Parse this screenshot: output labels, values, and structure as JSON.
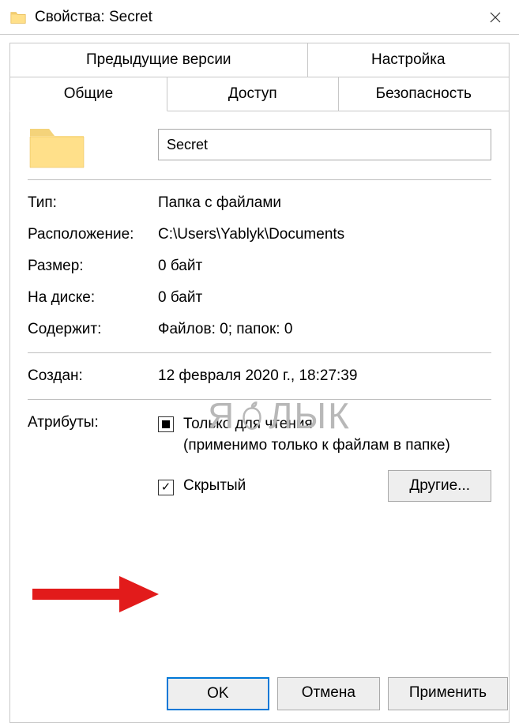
{
  "window": {
    "title": "Свойства: Secret"
  },
  "tabs": {
    "prev_versions": "Предыдущие версии",
    "settings": "Настройка",
    "general": "Общие",
    "sharing": "Доступ",
    "security": "Безопасность"
  },
  "name": {
    "value": "Secret"
  },
  "fields": {
    "type_label": "Тип:",
    "type_value": "Папка с файлами",
    "location_label": "Расположение:",
    "location_value": "C:\\Users\\Yablyk\\Documents",
    "size_label": "Размер:",
    "size_value": "0 байт",
    "size_on_disk_label": "На диске:",
    "size_on_disk_value": "0 байт",
    "contains_label": "Содержит:",
    "contains_value": "Файлов: 0; папок: 0",
    "created_label": "Создан:",
    "created_value": "12 февраля 2020 г., 18:27:39"
  },
  "attributes": {
    "label": "Атрибуты:",
    "readonly_line1": "Только для чтения",
    "readonly_line2": "(применимо только к файлам в папке)",
    "hidden_label": "Скрытый",
    "advanced_button": "Другие..."
  },
  "buttons": {
    "ok": "OK",
    "cancel": "Отмена",
    "apply": "Применить"
  },
  "watermark": "ЯБЛЫК"
}
